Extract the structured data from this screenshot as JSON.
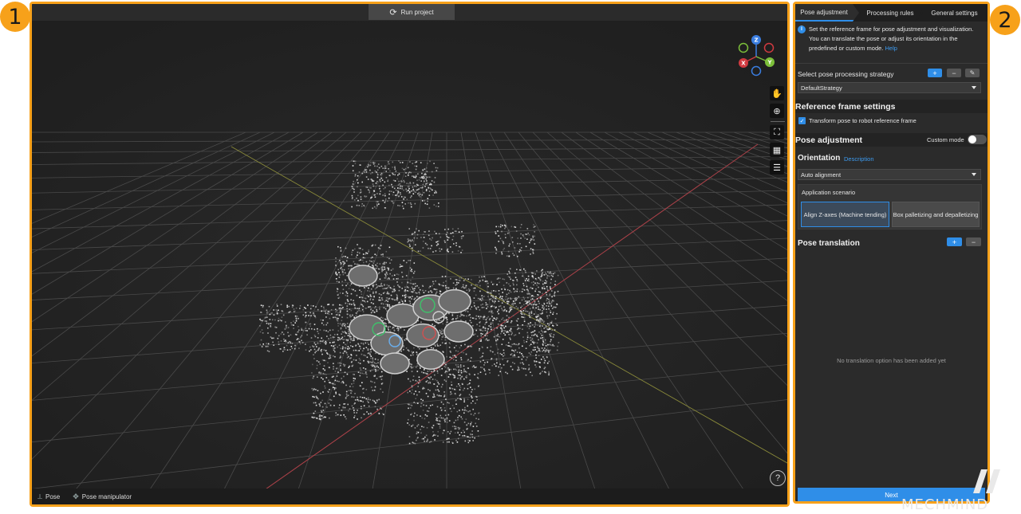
{
  "callouts": {
    "one": "1",
    "two": "2"
  },
  "viewer": {
    "run_button": "Run project",
    "run_icon": "refresh-icon",
    "bottom": {
      "pose": "Pose",
      "pose_manipulator": "Pose manipulator"
    },
    "gizmo": {
      "z": "Z",
      "x": "X",
      "y": "Y"
    },
    "tools": [
      "hand-icon",
      "zoom-icon",
      "fit-view-icon",
      "grid-icon",
      "legend-icon"
    ],
    "help": "?"
  },
  "panel": {
    "tabs": [
      "Pose adjustment",
      "Processing rules",
      "General settings"
    ],
    "info_text": "Set the reference frame for pose adjustment and visualization. You can translate the pose or adjust its orientation in the predefined or custom mode.",
    "info_link": "Help",
    "strategy_label": "Select pose processing strategy",
    "strategy_value": "DefaultStrategy",
    "ref_frame_title": "Reference frame settings",
    "ref_frame_checkbox": "Transform pose to robot reference frame",
    "pose_adjustment_title": "Pose adjustment",
    "custom_mode": "Custom mode",
    "orientation_title": "Orientation",
    "orientation_desc": "Description",
    "orientation_value": "Auto alignment",
    "scenario_label": "Application scenario",
    "scenario_align": "Align Z-axes (Machine tending)",
    "scenario_box": "Box palletizing and depalletizing",
    "translation_title": "Pose translation",
    "empty_message": "No translation option has been added yet",
    "next": "Next"
  },
  "colors": {
    "accent": "#f7a11a",
    "blue": "#2f8ee8",
    "panel_bg": "#2b2b2b",
    "viewer_bg": "#262626"
  },
  "watermark": "MECHMIND"
}
